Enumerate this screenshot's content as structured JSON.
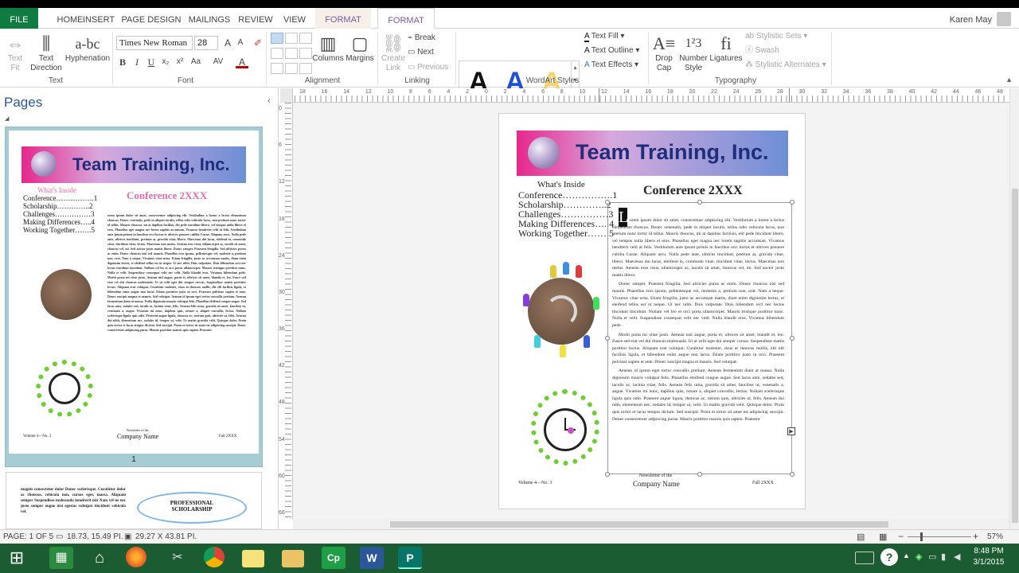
{
  "colors": {
    "accent": "#107c41",
    "publisher": "#2b579a",
    "pink": "#e36fa8",
    "navy": "#1f2d7a"
  },
  "ribbon_tabs": [
    "FILE",
    "HOME",
    "INSERT",
    "PAGE DESIGN",
    "MAILINGS",
    "REVIEW",
    "VIEW",
    "FORMAT",
    "FORMAT"
  ],
  "user": "Karen May",
  "text_group": {
    "text_fit": "Text\nFit",
    "text_direction": "Text\nDirection",
    "hyphenation": "Hyphenation",
    "label": "Text"
  },
  "font_group": {
    "font_name": "Times New Roman",
    "font_size": "28",
    "label": "Font",
    "bold": "B",
    "italic": "I",
    "underline": "U"
  },
  "alignment_group": {
    "columns": "Columns",
    "margins": "Margins",
    "label": "Alignment"
  },
  "linking_group": {
    "create_link": "Create\nLink",
    "break": "Break",
    "next": "Next",
    "previous": "Previous",
    "label": "Linking"
  },
  "wordart_group": {
    "text_fill": "Text Fill",
    "text_outline": "Text Outline",
    "text_effects": "Text Effects",
    "label": "WordArt Styles",
    "sample": "A"
  },
  "typography_group": {
    "drop_cap": "Drop\nCap",
    "number_style": "Number\nStyle",
    "ligatures": "Ligatures",
    "stylistic_sets": "Stylistic Sets",
    "swash": "Swash",
    "stylistic_alternates": "Stylistic Alternates",
    "label": "Typography"
  },
  "pages_pane": {
    "title": "Pages",
    "page_number": "1"
  },
  "newsletter": {
    "banner": "Team Training, Inc.",
    "whats_inside": "What's Inside",
    "conference": "Conference 2XXX",
    "toc": [
      "Conference…………….1",
      "Scholarship…………..2",
      "Challenges……………3",
      "Making Differences…..4",
      "Working Together…….5"
    ],
    "footer_left": "Volume 4—No. 3",
    "footer_center_small": "Newsletter of the",
    "footer_center": "Company Name",
    "footer_right": "Fall 2XXX",
    "body_p1": "orem ipsum dolor sit amet, consectetuer adipiscing elit. Vestibulum a lorem a lectus elementum rhoncus. Donec venenatis, pede in aliquet iaculis, tellus odio vehicula lacus, non pretium nunc tortor id tellus. Mauris rhoncus, mi at dapibus facilisis, elit pede tincidunt libero, vel tempus nulla libero et eros. Phasellus eget magna nec lorem sagittis accumsan. Vivamus hendrerit velit ut felis. Vestibulum ante ipsum primis in faucibus orci luctus et ultrices posuere cubilia Curae; Aliquam arcu. Nulla pede ante, ultrices tincidunt, pretium at, gravida vitae, libero. Maecenas dui lacus, eleifend in, commodo vitae, tincidunt vitae, lectus. Maecenas non metus. Aenean eros risus, ullamcorper ac, iaculis sit amet, rhoncus vel, mi. Sed auctor justo mattis libero.",
    "body_p2": "Donec semper. Praesent fringilla. Sed ultricies purus ac enim. Donec rhoncus nisi sed mauris. Phasellus eros ipsum, pellentesque vel, molestie a, pretium non, erat. Nam a neque. Vivamus vitae urna. Etiam fringilla, justo ac accumsan mattis, diam enim dignissim lectus, et eleifend tellus est ut neque. Ut nec nibh. Duis vulputate. Duis bibendum orci nec lectus tincidunt tincidunt. Nullam vel leo et orci porta ullamcorper. Mauris tristique porttitor nunc. Nulla et velit. Suspendisse consequat velit nec velit. Nulla blandit eros. Vivamus bibendum pede.",
    "body_p3": "Morbi porta mi vitae justo. Aenean nisl augue, porta et, ultrices sit amet, blandit et, leo. Fusce sed erat vel dui rhoncus malesuada. Ut ut velit eget dui semper cursus. Suspendisse mattis porttitor lectus. Aliquam erat volutpat. Curabitur molestie, risus at rhoncus mollis, elit elit facilisis ligula, et bibendum enim augue non lacus. Etiam porttitor justo in orci. Praesent pulvinar sapien et ante. Donec suscipit magna et mauris. Sed volutpat.",
    "body_p4": "Aenean id ipsum eget tortor convallis pretium. Aenean fermentum diam at massa. Nulla dignissim mauris volutpat felis. Phasellus eleifend congue augue. Sed lacus ante, sodales sed, iaculis ac, lacinia vitae, felis. Aenean felis urna, gravida sit amet, faucibus ut, venenatis a, augue. Vivamus mi nunc, dapibus quis, ornare a, aliquet convallis, lectus. Nullam scelerisque ligula quis odio. Praesent augue ligula, rhoncus ac, rutrum quis, ultricies ut, felis. Aenean dui nibh, elementum nec, sodales id, tempor ut, velit. Ut mattis gravida velit. Quisque dolor. Proin quis tortor et lacus tempor dictum. Sed suscipit. Proin et tortor sit amet est adipiscing suscipit. Donec consectetuer adipiscing purus. Mauris porttitor mauris quis sapien. Praesent"
  },
  "thumb2": {
    "text": "magnis consectetur dolor Donec scelerisque. Curabitur dolor ac rhoncus, vehicula non, cursus eget, massa. Aliquam semper Suspendisse malesuada hendrerit nisi Nam vel ne nec justo semper augue nisi egestas volutpat tincidunt vehicula vel.",
    "badge": "PROFESSIONAL SCHOLARSHIP"
  },
  "ruler_h": [
    "18",
    "16",
    "14",
    "12",
    "10",
    "8",
    "6",
    "4",
    "2",
    "0",
    "2",
    "4",
    "6",
    "8",
    "10",
    "12",
    "14",
    "16",
    "18",
    "20",
    "22",
    "24",
    "26",
    "28",
    "30",
    "32",
    "34",
    "36",
    "38",
    "40",
    "42",
    "44",
    "46",
    "48"
  ],
  "ruler_v": [
    "0",
    "6",
    "12",
    "18",
    "24",
    "30",
    "36",
    "42",
    "48",
    "54",
    "60",
    "66"
  ],
  "status": {
    "page": "PAGE: 1 OF 5",
    "position": "18.73, 15.49 PI.",
    "size": "29.27 X 43.81 PI.",
    "zoom": "57%"
  },
  "clock": {
    "time": "8:48 PM",
    "date": "3/1/2015"
  }
}
